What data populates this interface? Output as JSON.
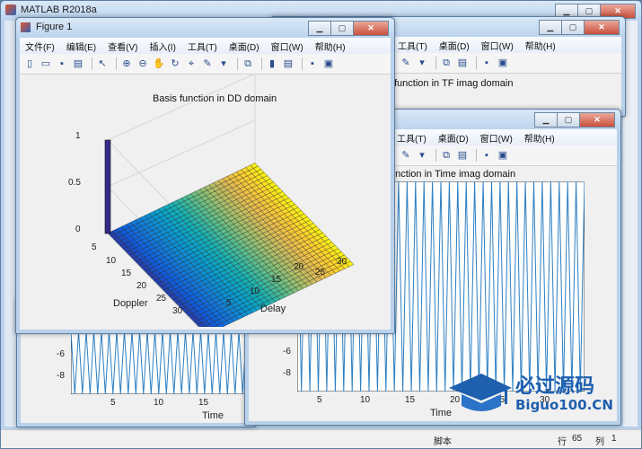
{
  "matlab": {
    "title": "MATLAB R2018a",
    "status": {
      "script_label": "脚本",
      "row_label": "行",
      "row": "65",
      "col_label": "列",
      "col": "1"
    }
  },
  "figure1": {
    "title": "Figure 1",
    "menu": [
      "文件(F)",
      "编辑(E)",
      "查看(V)",
      "插入(I)",
      "工具(T)",
      "桌面(D)",
      "窗口(W)",
      "帮助(H)"
    ],
    "plot": {
      "title": "Basis function in DD domain",
      "z_ticks": [
        "1",
        "0.5",
        "0"
      ],
      "doppler_ticks": [
        "5",
        "10",
        "15",
        "20",
        "25",
        "30"
      ],
      "delay_ticks": [
        "5",
        "10",
        "15",
        "20",
        "25",
        "30"
      ],
      "xlabel": "Doppler",
      "ylabel": "Delay"
    }
  },
  "figure_tf": {
    "menu": [
      "工具(T)",
      "桌面(D)",
      "窗口(W)",
      "帮助(H)"
    ],
    "title_partial": "function in TF imag domain"
  },
  "figure_time": {
    "menu": [
      "工具(T)",
      "桌面(D)",
      "窗口(W)",
      "帮助(H)"
    ],
    "title_partial": "function in Time imag domain",
    "y_ticks": [
      "-6",
      "-8"
    ],
    "x_ticks": [
      "5",
      "10",
      "15",
      "20",
      "25",
      "30"
    ],
    "xlabel": "Time"
  },
  "figure_bottom_left": {
    "y_ticks": [
      "-6",
      "-8"
    ],
    "x_ticks": [
      "5",
      "10",
      "15"
    ],
    "xlabel": "Time"
  },
  "watermark": {
    "line1": "必过源码",
    "line2": "Biguo100.CN"
  },
  "colors": {
    "surface_low": "#352a87",
    "surface_mid": "#21a1a3",
    "surface_high": "#f9fb0e",
    "wave": "#2d7fc1"
  }
}
